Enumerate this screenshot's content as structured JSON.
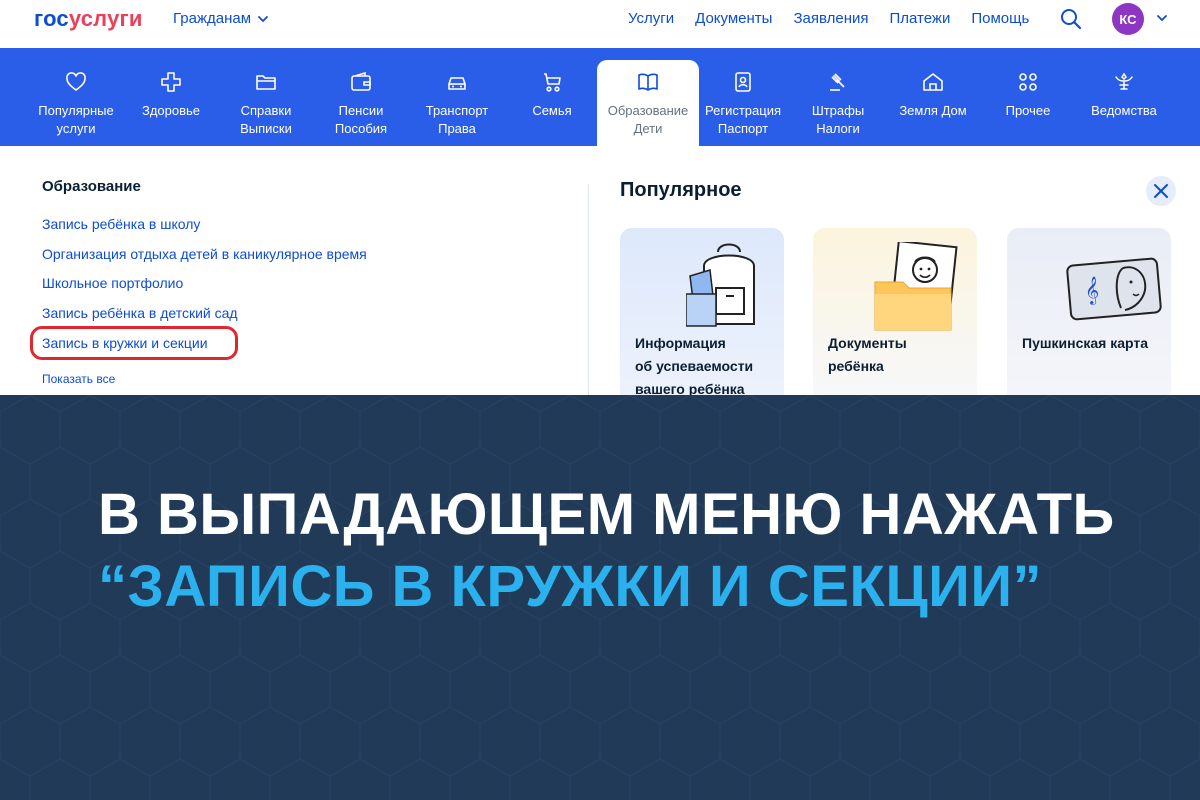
{
  "header": {
    "logo_part1": "гос",
    "logo_part2": "услуги",
    "citizens_label": "Гражданам",
    "nav": [
      "Услуги",
      "Документы",
      "Заявления",
      "Платежи",
      "Помощь"
    ],
    "avatar_initials": "КС"
  },
  "categories": [
    {
      "label": "Популярные\nуслуги",
      "icon": "heart-icon"
    },
    {
      "label": "Здоровье",
      "icon": "medical-cross-icon"
    },
    {
      "label": "Справки\nВыписки",
      "icon": "folder-icon"
    },
    {
      "label": "Пенсии\nПособия",
      "icon": "wallet-icon"
    },
    {
      "label": "Транспорт\nПрава",
      "icon": "car-icon"
    },
    {
      "label": "Семья",
      "icon": "stroller-icon"
    },
    {
      "label": "Образование\nДети",
      "icon": "book-icon"
    },
    {
      "label": "Регистрация\nПаспорт",
      "icon": "passport-icon"
    },
    {
      "label": "Штрафы\nНалоги",
      "icon": "gavel-icon"
    },
    {
      "label": "Земля Дом",
      "icon": "house-icon"
    },
    {
      "label": "Прочее",
      "icon": "grid-icon"
    },
    {
      "label": "Ведомства",
      "icon": "emblem-icon"
    }
  ],
  "active_category": "Образование\nДети",
  "education": {
    "title": "Образование",
    "links": [
      "Запись ребёнка в школу",
      "Организация отдыха детей в каникулярное время",
      "Школьное портфолио",
      "Запись ребёнка в детский сад",
      "Запись в кружки и секции"
    ],
    "show_all": "Показать все"
  },
  "popular": {
    "title": "Популярное",
    "cards": [
      {
        "title": "Информация\nоб успеваемости\nвашего ребёнка",
        "icon": "backpack-icon"
      },
      {
        "title": "Документы\nребёнка",
        "icon": "child-documents-icon"
      },
      {
        "title": "Пушкинская карта",
        "icon": "pushkin-card-icon"
      }
    ]
  },
  "banner": {
    "line_part1": "В ВЫПАДАЮЩЕМ МЕНЮ НАЖАТЬ ",
    "line_part2": "“ЗАПИСЬ В КРУЖКИ И СЕКЦИИ”"
  },
  "colors": {
    "brand_blue": "#0d4cd3",
    "category_bar": "#2a5ee8",
    "banner_bg": "#203a58",
    "banner_highlight": "#2ab1ee",
    "highlight_outline": "#e0272e",
    "avatar": "#8d36c4"
  }
}
